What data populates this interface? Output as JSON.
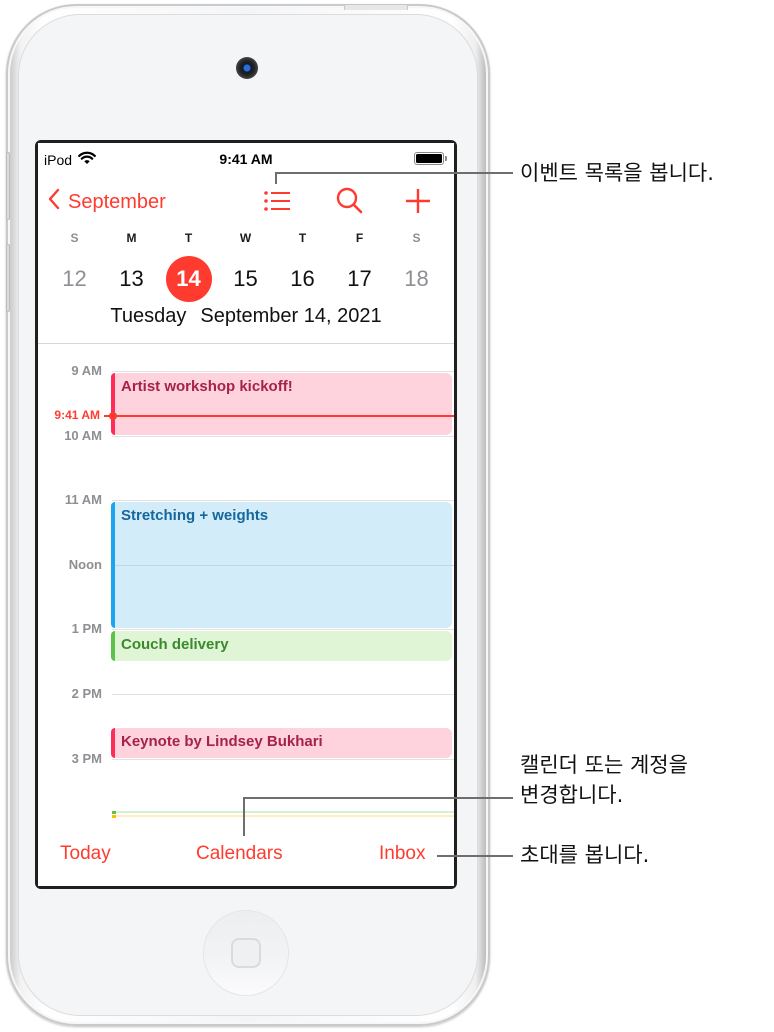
{
  "status_bar": {
    "carrier": "iPod",
    "time": "9:41 AM",
    "wifi_icon": "wifi-icon",
    "battery_icon": "battery-full-icon"
  },
  "nav": {
    "back_label": "September",
    "back_icon": "chevron-left-icon",
    "list_icon": "list-icon",
    "search_icon": "search-icon",
    "add_icon": "plus-icon"
  },
  "week": {
    "days": [
      {
        "letter": "S",
        "date": "12",
        "weekend": true,
        "selected": false
      },
      {
        "letter": "M",
        "date": "13",
        "weekend": false,
        "selected": false
      },
      {
        "letter": "T",
        "date": "14",
        "weekend": false,
        "selected": true
      },
      {
        "letter": "W",
        "date": "15",
        "weekend": false,
        "selected": false
      },
      {
        "letter": "T",
        "date": "16",
        "weekend": false,
        "selected": false
      },
      {
        "letter": "F",
        "date": "17",
        "weekend": false,
        "selected": false
      },
      {
        "letter": "S",
        "date": "18",
        "weekend": true,
        "selected": false
      }
    ],
    "selected_weekday": "Tuesday",
    "selected_full_date": "September 14, 2021"
  },
  "timeline": {
    "hours": [
      "9 AM",
      "10 AM",
      "11 AM",
      "Noon",
      "1 PM",
      "2 PM",
      "3 PM"
    ],
    "now_label": "9:41 AM",
    "events": [
      {
        "title": "Artist workshop kickoff!",
        "color": "pink",
        "start": "9:00",
        "end": "10:00"
      },
      {
        "title": "Stretching + weights",
        "color": "blue",
        "start": "11:00",
        "end": "13:00"
      },
      {
        "title": "Couch delivery",
        "color": "green",
        "start": "13:00",
        "end": "13:30"
      },
      {
        "title": "Keynote by Lindsey Bukhari",
        "color": "pink",
        "start": "14:30",
        "end": "15:00"
      }
    ]
  },
  "toolbar": {
    "today": "Today",
    "calendars": "Calendars",
    "inbox": "Inbox"
  },
  "colors": {
    "accent": "#ff3b30",
    "event_pink": "#ffd3de",
    "event_blue": "#d2ecfa",
    "event_green": "#dff5d6"
  },
  "callouts": {
    "event_list": "이벤트 목록을 봅니다.",
    "calendars_line1": "캘린더 또는 계정을",
    "calendars_line2": "변경합니다.",
    "inbox": "초대를 봅니다."
  }
}
